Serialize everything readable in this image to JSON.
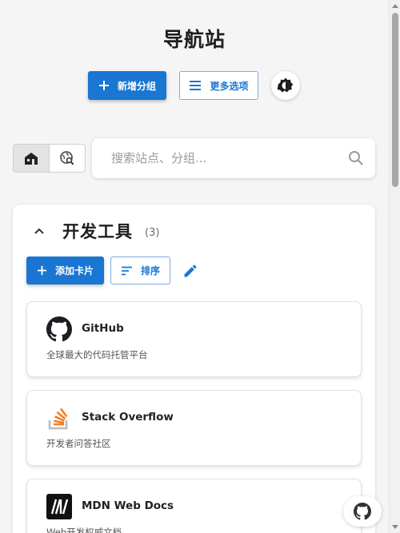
{
  "header": {
    "title": "导航站",
    "add_group_label": "新增分组",
    "more_options_label": "更多选项"
  },
  "search": {
    "placeholder": "搜索站点、分组..."
  },
  "group": {
    "title": "开发工具",
    "count": "(3)",
    "add_card_label": "添加卡片",
    "sort_label": "排序",
    "sites": [
      {
        "name": "GitHub",
        "description": "全球最大的代码托管平台",
        "icon": "github-logo"
      },
      {
        "name": "Stack Overflow",
        "description": "开发者问答社区",
        "icon": "stackoverflow-logo"
      },
      {
        "name": "MDN Web Docs",
        "description": "Web开发权威文档",
        "icon": "mdn-logo"
      }
    ]
  },
  "colors": {
    "primary": "#1976d2",
    "background": "#f5f5f5",
    "card": "#ffffff",
    "stackoverflow_orange": "#f48024"
  }
}
